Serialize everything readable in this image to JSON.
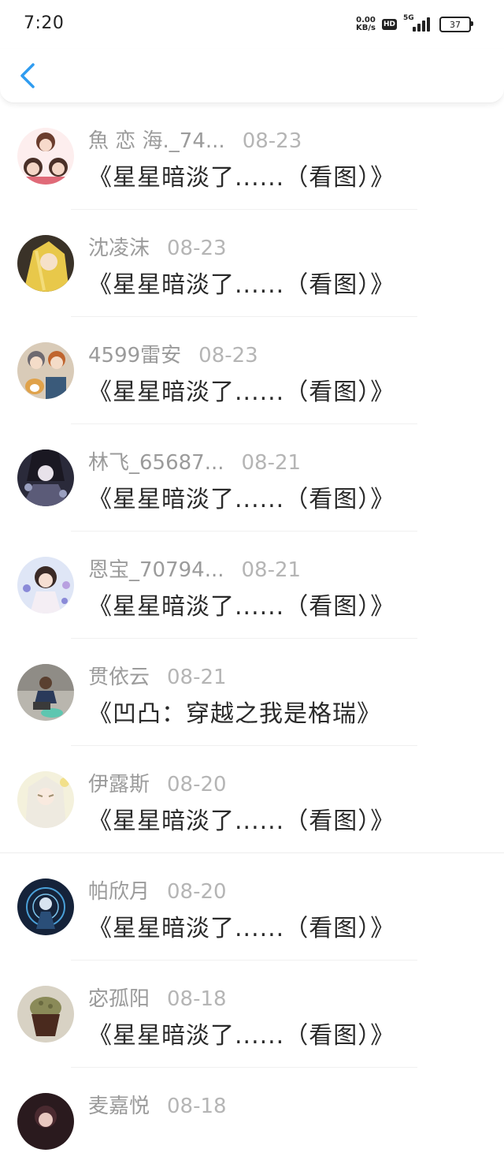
{
  "status_bar": {
    "time": "7:20",
    "net_speed_value": "0.00",
    "net_speed_unit": "KB/s",
    "hd_label": "HD",
    "network_label": "5G",
    "battery_level": "37"
  },
  "colors": {
    "accent": "#2f9cf0",
    "name_text": "#9b9b9b",
    "date_text": "#b5b5b5",
    "title_text": "#2a2a2a"
  },
  "list": {
    "items": [
      {
        "name": "魚 恋 海._74...",
        "date": "08-23",
        "title": "《星星暗淡了......（看图）》",
        "avatar": "anime-girl-avatar"
      },
      {
        "name": "沈凌沫",
        "date": "08-23",
        "title": "《星星暗淡了......（看图）》",
        "avatar": "blonde-anime-avatar"
      },
      {
        "name": "4599雷安",
        "date": "08-23",
        "title": "《星星暗淡了......（看图）》",
        "avatar": "anime-boys-dog-avatar"
      },
      {
        "name": "林飞_65687...",
        "date": "08-21",
        "title": "《星星暗淡了......（看图）》",
        "avatar": "dark-anime-avatar"
      },
      {
        "name": "恩宝_70794...",
        "date": "08-21",
        "title": "《星星暗淡了......（看图）》",
        "avatar": "anime-girl-flowers-avatar"
      },
      {
        "name": "贯依云",
        "date": "08-21",
        "title": "《凹凸：穿越之我是格瑞》",
        "avatar": "man-photo-avatar"
      },
      {
        "name": "伊露斯",
        "date": "08-20",
        "title": "《星星暗淡了......（看图）》",
        "avatar": "white-hair-anime-avatar"
      },
      {
        "name": "帕欣月",
        "date": "08-20",
        "title": "《星星暗淡了......（看图）》",
        "avatar": "blue-tech-anime-avatar"
      },
      {
        "name": "宓孤阳",
        "date": "08-18",
        "title": "《星星暗淡了......（看图）》",
        "avatar": "cupcake-avatar"
      },
      {
        "name": "麦嘉悦",
        "date": "08-18",
        "title": "",
        "avatar": "dark-portrait-avatar"
      }
    ]
  }
}
